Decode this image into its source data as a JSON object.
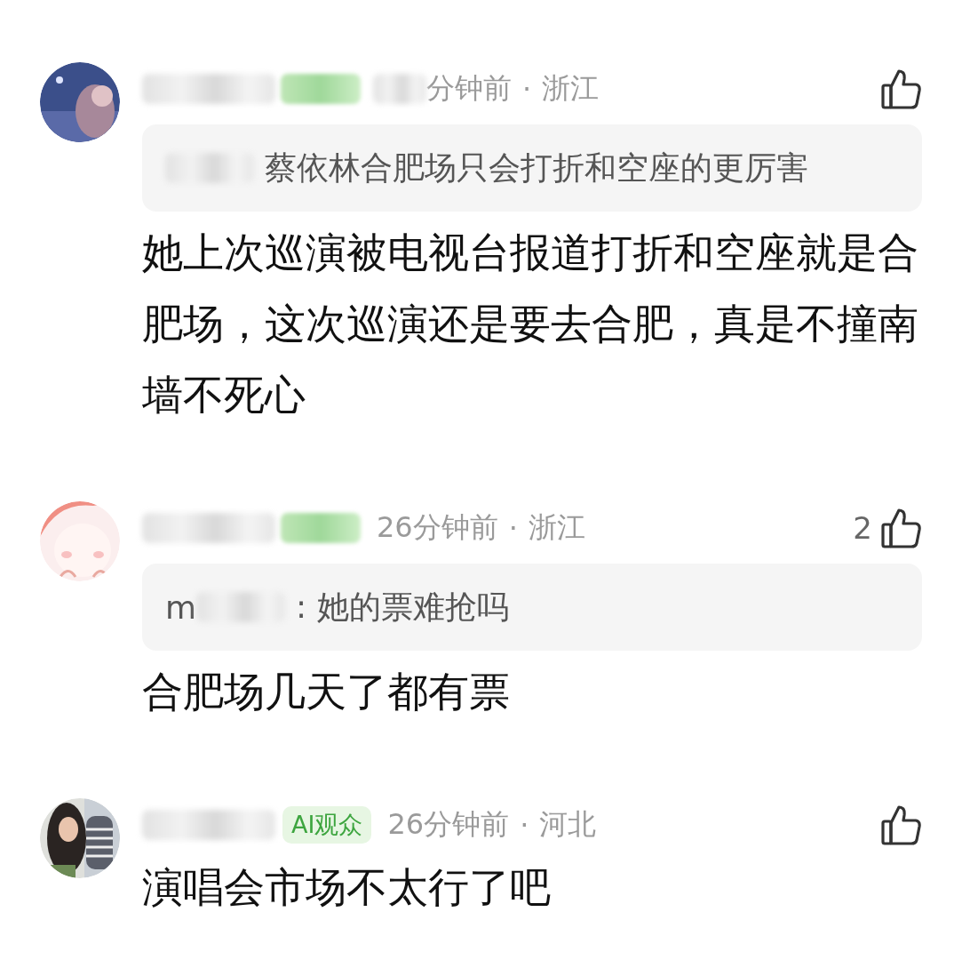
{
  "comments": [
    {
      "name_hidden": true,
      "badge": {
        "hidden": true
      },
      "time_partly_hidden": true,
      "time": "分钟前",
      "separator": "·",
      "location": "浙江",
      "quote": {
        "author_hidden": true,
        "text": "蔡依林合肥场只会打折和空座的更厉害"
      },
      "body": "她上次巡演被电视台报道打折和空座就是合肥场，这次巡演还是要去合肥，真是不撞南墙不死心"
    },
    {
      "name_hidden": true,
      "badge": {
        "hidden": true
      },
      "time_partly_hidden": false,
      "time": "26分钟前",
      "separator": "·",
      "location": "浙江",
      "likes": "2",
      "quote": {
        "author_hidden": true,
        "author": "m",
        "text": ": 她的票难抢吗"
      },
      "body": "合肥场几天了都有票"
    },
    {
      "name_hidden": true,
      "badge": {
        "hidden": false,
        "text": "AI观众"
      },
      "time_partly_hidden": false,
      "time": "26分钟前",
      "separator": "·",
      "location": "河北",
      "body": "演唱会市场不太行了吧"
    }
  ]
}
